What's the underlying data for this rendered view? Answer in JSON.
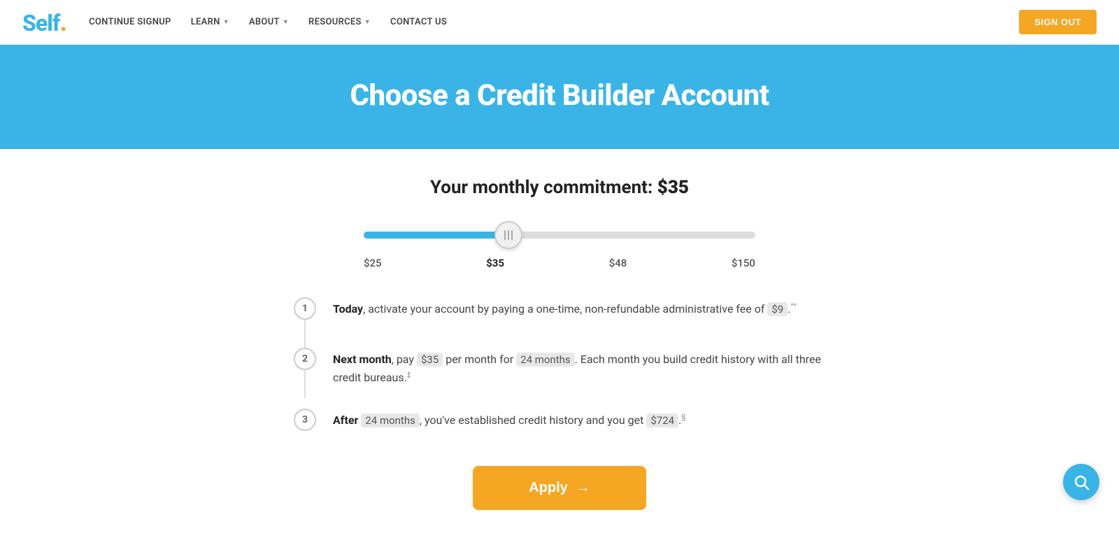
{
  "nav": {
    "logo": "Self",
    "logo_dot": ".",
    "links": [
      {
        "label": "CONTINUE SIGNUP",
        "has_dropdown": false
      },
      {
        "label": "LEARN",
        "has_dropdown": true
      },
      {
        "label": "ABOUT",
        "has_dropdown": true
      },
      {
        "label": "RESOURCES",
        "has_dropdown": true
      },
      {
        "label": "CONTACT US",
        "has_dropdown": false
      }
    ],
    "signout_label": "SIGN OUT"
  },
  "hero": {
    "title": "Choose a Credit Builder Account"
  },
  "commitment": {
    "label": "Your monthly commitment:",
    "amount": "$35"
  },
  "slider": {
    "options": [
      "$25",
      "$35",
      "$48",
      "$150"
    ],
    "active_index": 1
  },
  "steps": [
    {
      "number": "1",
      "text_before": "Today",
      "text_after": ", activate your account by paying a one-time, non-refundable administrative fee of ",
      "highlight": "$9",
      "sup": "^^",
      "text_end": ""
    },
    {
      "number": "2",
      "text_before": "Next month",
      "text_after": ", pay ",
      "highlight1": "$35",
      "text_mid": " per month for ",
      "highlight2": "24 months",
      "text_end": ". Each month you build credit history with all three credit bureaus.",
      "sup": "‡"
    },
    {
      "number": "3",
      "text_before": "After",
      "text_after": " ",
      "highlight1": "24 months",
      "text_mid": ", you've established credit history and you get ",
      "highlight2": "$724",
      "text_end": ".",
      "sup": "§"
    }
  ],
  "apply_button": {
    "label": "Apply",
    "arrow": "→"
  },
  "help_button": {
    "aria": "Search help"
  }
}
